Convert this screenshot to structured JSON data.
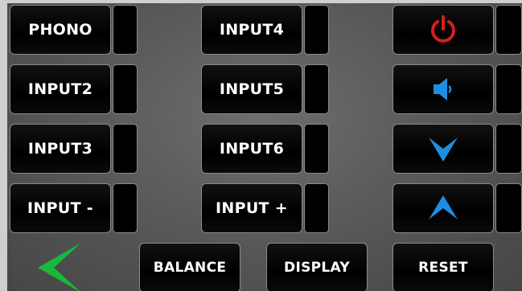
{
  "panel": {
    "column1": [
      "PHONO",
      "INPUT2",
      "INPUT3",
      "INPUT -"
    ],
    "column2": [
      "INPUT4",
      "INPUT5",
      "INPUT6",
      "INPUT +"
    ],
    "bottom_row": {
      "balance_label": "BALANCE",
      "display_label": "DISPLAY",
      "reset_label": "RESET"
    }
  },
  "icons": {
    "power": "power-icon",
    "speaker": "speaker-icon",
    "down": "chevron-down-icon",
    "up": "chevron-up-icon",
    "back": "back-arrow-icon"
  },
  "colors": {
    "power": "#d41f1f",
    "blue_icons": "#1e8ee0",
    "back_arrow": "#19b83a"
  }
}
